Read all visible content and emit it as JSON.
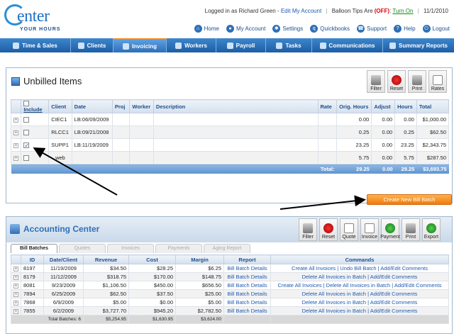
{
  "header": {
    "logo_main": "enter",
    "logo_sub": "YOUR HOURS",
    "logged_in_prefix": "Logged in as Richard Green - ",
    "edit_account": "Edit My Account",
    "balloon_prefix": "Balloon Tips Are ",
    "balloon_state": "(OFF)",
    "turn_on": "Turn On",
    "date": "11/1/2010",
    "links": [
      {
        "label": "Home",
        "icon": "home-icon"
      },
      {
        "label": "My Account",
        "icon": "user-icon"
      },
      {
        "label": "Settings",
        "icon": "gear-icon"
      },
      {
        "label": "Quickbooks",
        "icon": "quickbooks-icon"
      },
      {
        "label": "Support",
        "icon": "support-icon"
      },
      {
        "label": "Help",
        "icon": "help-icon"
      },
      {
        "label": "Logout",
        "icon": "logout-icon"
      }
    ]
  },
  "nav": [
    {
      "label": "Time & Sales",
      "active": false
    },
    {
      "label": "Clients",
      "active": false
    },
    {
      "label": "Invoicing",
      "active": true
    },
    {
      "label": "Workers",
      "active": false
    },
    {
      "label": "Payroll",
      "active": false
    },
    {
      "label": "Tasks",
      "active": false
    },
    {
      "label": "Communications",
      "active": false
    },
    {
      "label": "Summary Reports",
      "active": false
    }
  ],
  "unbilled": {
    "title": "Unbilled Items",
    "toolbar": [
      "Filter",
      "Reset",
      "Print",
      "Rates"
    ],
    "columns": [
      "Include",
      "Client",
      "Date",
      "Proj",
      "Worker",
      "Description",
      "Rate",
      "Orig. Hours",
      "Adjust",
      "Hours",
      "Total"
    ],
    "rows": [
      {
        "checked": false,
        "client": "CIEC1",
        "date": "LB:06/09/2009",
        "orig": "0.00",
        "adjust": "0.00",
        "hours": "0.00",
        "total": "$1,000.00"
      },
      {
        "checked": false,
        "client": "RLCC1",
        "date": "LB:09/21/2008",
        "orig": "0.25",
        "adjust": "0.00",
        "hours": "0.25",
        "total": "$62.50"
      },
      {
        "checked": true,
        "client": "SUPP1",
        "date": "LB:11/19/2009",
        "orig": "23.25",
        "adjust": "0.00",
        "hours": "23.25",
        "total": "$2,343.75"
      },
      {
        "checked": false,
        "client": "web",
        "date": "",
        "orig": "5.75",
        "adjust": "0.00",
        "hours": "5.75",
        "total": "$287.50"
      }
    ],
    "total_label": "Total:",
    "total_orig": "29.25",
    "total_adjust": "0.00",
    "total_hours": "29.25",
    "total_total": "$3,693.75"
  },
  "create_button": "Create New Bill Batch",
  "accounting": {
    "title": "Accounting Center",
    "toolbar": [
      "Filter",
      "Reset",
      "Quote",
      "Invoice",
      "Payment",
      "Print",
      "Export"
    ],
    "tabs": [
      {
        "label": "Bill Batches",
        "active": true
      },
      {
        "label": "Quotes",
        "active": false
      },
      {
        "label": "Invoices",
        "active": false
      },
      {
        "label": "Payments",
        "active": false
      },
      {
        "label": "Aging Report",
        "active": false
      }
    ],
    "columns": [
      "ID",
      "Date/Client",
      "Revenue",
      "Cost",
      "Margin",
      "Report",
      "Commands"
    ],
    "rows": [
      {
        "id": "8197",
        "date": "11/19/2009",
        "revenue": "$34.50",
        "cost": "$28.25",
        "margin": "$6.25",
        "report": "Bill Batch Details",
        "commands": "Create All Invoices | Undo Bill Batch | Add/Edit Comments"
      },
      {
        "id": "8179",
        "date": "11/12/2009",
        "revenue": "$318.75",
        "cost": "$170.00",
        "margin": "$148.75",
        "report": "Bill Batch Details",
        "commands": "Delete All Invoices in Batch | Add/Edit Comments"
      },
      {
        "id": "8081",
        "date": "9/23/2009",
        "revenue": "$1,106.50",
        "cost": "$450.00",
        "margin": "$656.50",
        "report": "Bill Batch Details",
        "commands": "Create All Invoices | Delete All Invoices in Batch | Add/Edit Comments"
      },
      {
        "id": "7894",
        "date": "6/25/2009",
        "revenue": "$62.50",
        "cost": "$37.50",
        "margin": "$25.00",
        "report": "Bill Batch Details",
        "commands": "Delete All Invoices in Batch | Add/Edit Comments"
      },
      {
        "id": "7868",
        "date": "6/9/2009",
        "revenue": "$5.00",
        "cost": "$0.00",
        "margin": "$5.00",
        "report": "Bill Batch Details",
        "commands": "Delete All Invoices in Batch | Add/Edit Comments"
      },
      {
        "id": "7855",
        "date": "6/2/2009",
        "revenue": "$3,727.70",
        "cost": "$945.20",
        "margin": "$2,782.50",
        "report": "Bill Batch Details",
        "commands": "Delete All Invoices in Batch | Add/Edit Comments"
      }
    ],
    "footer": {
      "label": "Total Batches: 6",
      "revenue": "$5,254.95",
      "cost": "$1,630.95",
      "margin": "$3,624.00"
    }
  }
}
